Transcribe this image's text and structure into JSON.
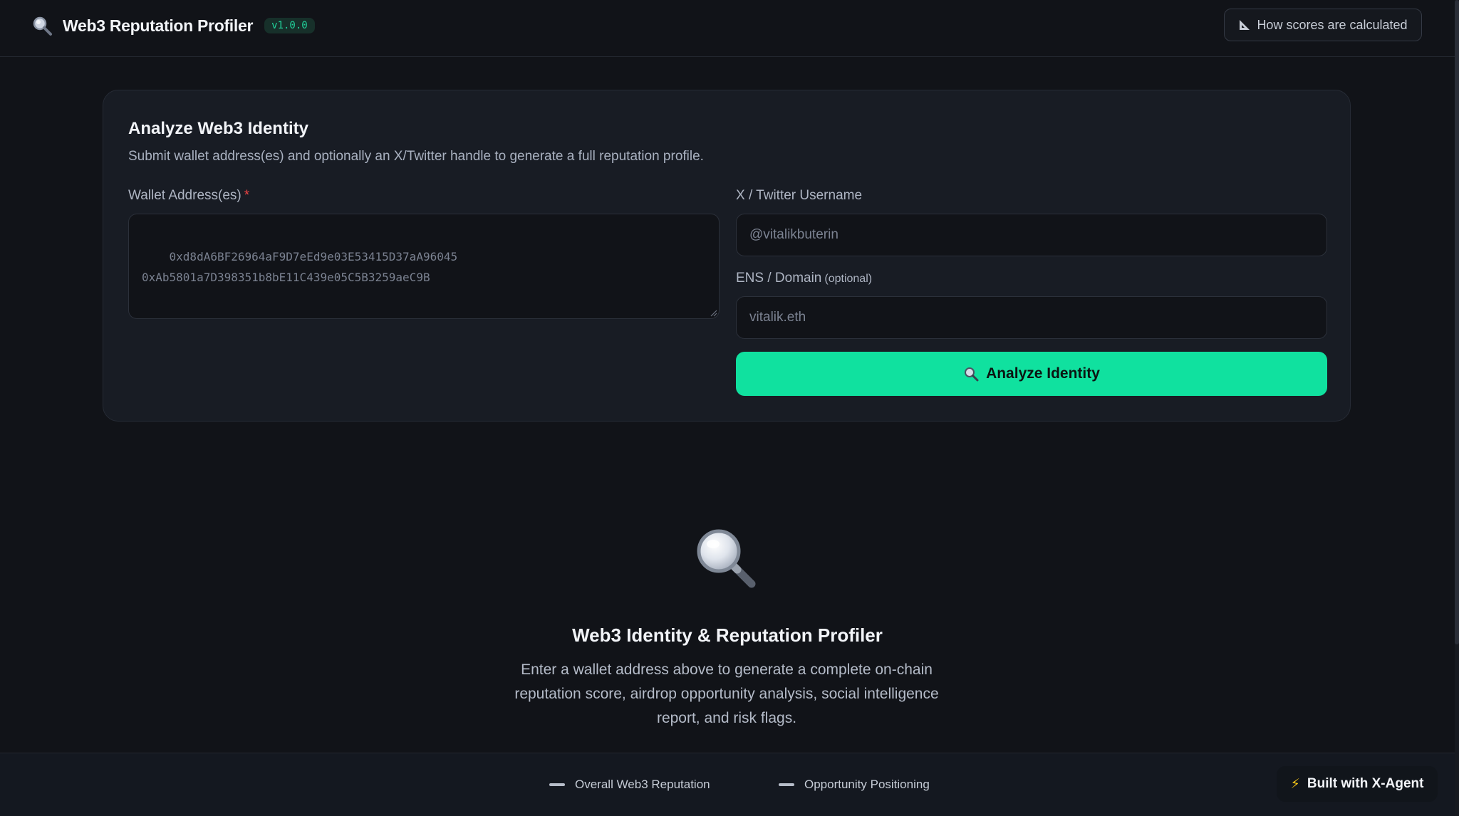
{
  "header": {
    "brand_icon": "magnifier-icon",
    "title": "Web3 Reputation Profiler",
    "version": "v1.0.0",
    "how_scores_label": "How scores are calculated",
    "how_scores_icon": "ruler-triangle-icon"
  },
  "card": {
    "title": "Analyze Web3 Identity",
    "subtitle": "Submit wallet address(es) and optionally an X/Twitter handle to generate a full reputation profile.",
    "wallet": {
      "label": "Wallet Address(es)",
      "required_mark": "*",
      "placeholder": "0xd8dA6BF26964aF9D7eEd9e03E53415D37aA96045\n0xAb5801a7D398351b8bE11C439e05C5B3259aeC9B"
    },
    "twitter": {
      "label": "X / Twitter Username",
      "placeholder": "@vitalikbuterin"
    },
    "ens": {
      "label": "ENS / Domain",
      "optional_note": "(optional)",
      "placeholder": "vitalik.eth"
    },
    "analyze_button": "Analyze Identity"
  },
  "empty_state": {
    "icon": "magnifier-icon",
    "title": "Web3 Identity & Reputation Profiler",
    "description": "Enter a wallet address above to generate a complete on-chain reputation score, airdrop opportunity analysis, social intelligence report, and risk flags."
  },
  "footer": {
    "metrics": [
      "Overall Web3 Reputation",
      "Opportunity Positioning"
    ],
    "built_with": "Built with X-Agent"
  },
  "colors": {
    "background": "#111318",
    "card": "#181c24",
    "accent": "#10e19f",
    "required": "#ef4444"
  }
}
